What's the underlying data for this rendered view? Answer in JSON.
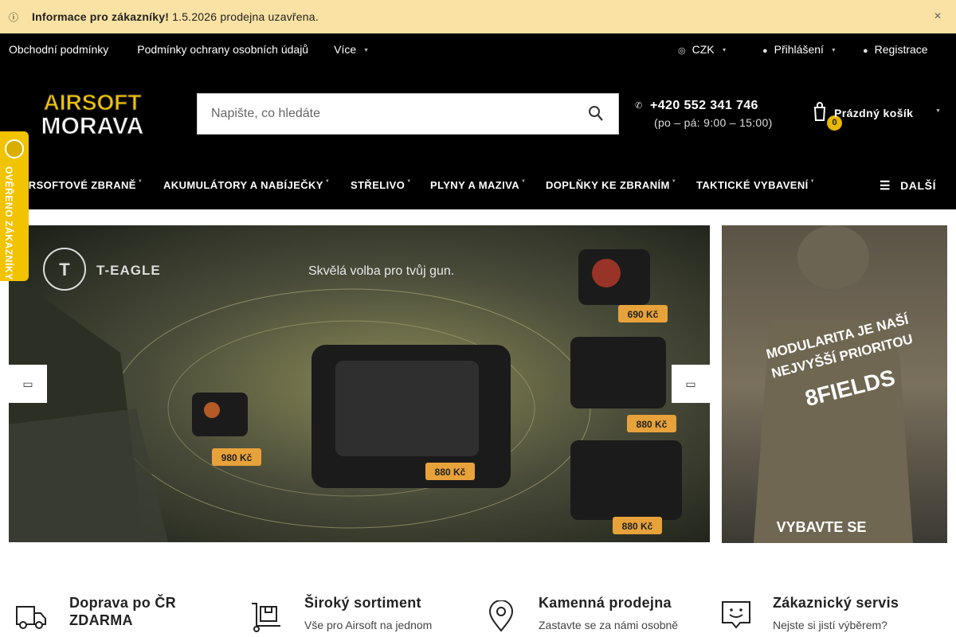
{
  "notice": {
    "icon": "info-icon",
    "title": "Informace pro zákazníky!",
    "text": "1.5.2026 prodejna uzavřena.",
    "close_icon": "close-icon"
  },
  "toplinks": {
    "items": [
      "Obchodní podmínky",
      "Podmínky ochrany osobních údajů",
      "Více"
    ],
    "currency": "CZK",
    "login": "Přihlášení",
    "register": "Registrace"
  },
  "header": {
    "logo_line1": "AIRSOFT",
    "logo_line2": "MORAVA",
    "search_placeholder": "Napište, co hledáte",
    "phone": "+420 552 341 746",
    "hours": "(po – pá: 9:00 – 15:00)",
    "cart_label": "Prázdný košík",
    "cart_count": "0"
  },
  "nav": {
    "items": [
      "AIRSOFTOVÉ ZBRANĚ",
      "AKUMULÁTORY A NABÍJEČKY",
      "STŘELIVO",
      "PLYNY A MAZIVA",
      "DOPLŇKY KE ZBRANÍM",
      "TAKTICKÉ VYBAVENÍ"
    ],
    "more": "DALŠÍ"
  },
  "verified": {
    "label": "OVĚŘENO ZÁKAZNÍKY"
  },
  "slider": {
    "brand": "T-EAGLE",
    "tagline": "Skvělá volba pro tvůj gun.",
    "prices": [
      "690 Kč",
      "880 Kč",
      "980 Kč",
      "880 Kč",
      "880 Kč"
    ]
  },
  "side_banner": {
    "line1": "MODULARITA JE NAŠÍ",
    "line2": "NEJVYŠŠÍ PRIORITOU",
    "brand": "8FIELDS",
    "cta": "VYBAVTE SE"
  },
  "features": [
    {
      "icon": "truck-icon",
      "title1": "Doprava po ČR",
      "title2": "ZDARMA",
      "desc": ""
    },
    {
      "icon": "box-cart-icon",
      "title1": "Široký sortiment",
      "title2": "",
      "desc": "Vše pro Airsoft na jednom"
    },
    {
      "icon": "location-pin-icon",
      "title1": "Kamenná prodejna",
      "title2": "",
      "desc": "Zastavte se za námi osobně"
    },
    {
      "icon": "support-chat-icon",
      "title1": "Zákaznický servis",
      "title2": "",
      "desc": "Nejste si jistí výběrem?"
    }
  ],
  "colors": {
    "notice_bg": "#f9e2a3",
    "header_bg": "#000000",
    "accent_yellow": "#f2c300",
    "badge": "#e6b800"
  }
}
